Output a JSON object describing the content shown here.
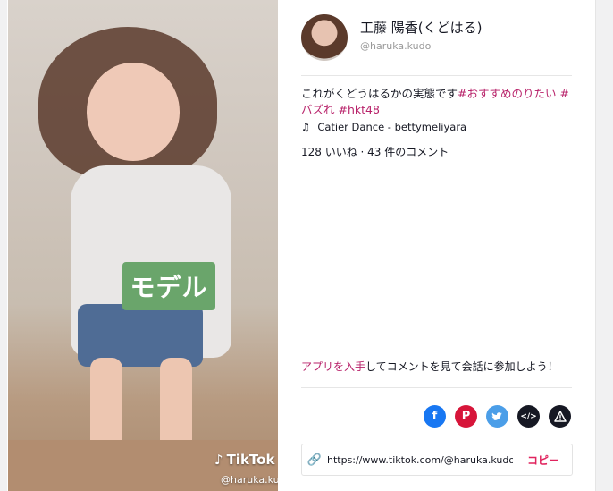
{
  "video": {
    "sticker_text": "モデル",
    "watermark_logo": "TikTok",
    "watermark_handle": "@haruka.kudo"
  },
  "profile": {
    "display_name": "工藤 陽香(くどはる)",
    "handle": "@haruka.kudo"
  },
  "caption": {
    "text": "これがくどうはるかの実態です",
    "hashtags": [
      "#おすすめのりたい",
      "#バズれ",
      "#hkt48"
    ]
  },
  "music": {
    "icon": "music-note-icon",
    "label": "Catier Dance - bettymeliyara"
  },
  "stats": {
    "text": "128 いいね · 43 件のコメント"
  },
  "cta": {
    "link_text": "アプリを入手",
    "rest_text": "してコメントを見て会話に参加しよう！"
  },
  "share": {
    "buttons": [
      {
        "icon": "facebook-icon",
        "color": "#1877f2"
      },
      {
        "icon": "pinterest-icon",
        "color": "#d7153a"
      },
      {
        "icon": "twitter-icon",
        "color": "#4b9ee8"
      },
      {
        "icon": "embed-code-icon",
        "color": "#161823"
      },
      {
        "icon": "report-icon",
        "color": "#161823"
      }
    ]
  },
  "url_box": {
    "url": "https://www.tiktok.com/@haruka.kudo/v",
    "copy_label": "コピー"
  },
  "colors": {
    "accent": "#e0245e",
    "hashtag": "#b8226a"
  }
}
